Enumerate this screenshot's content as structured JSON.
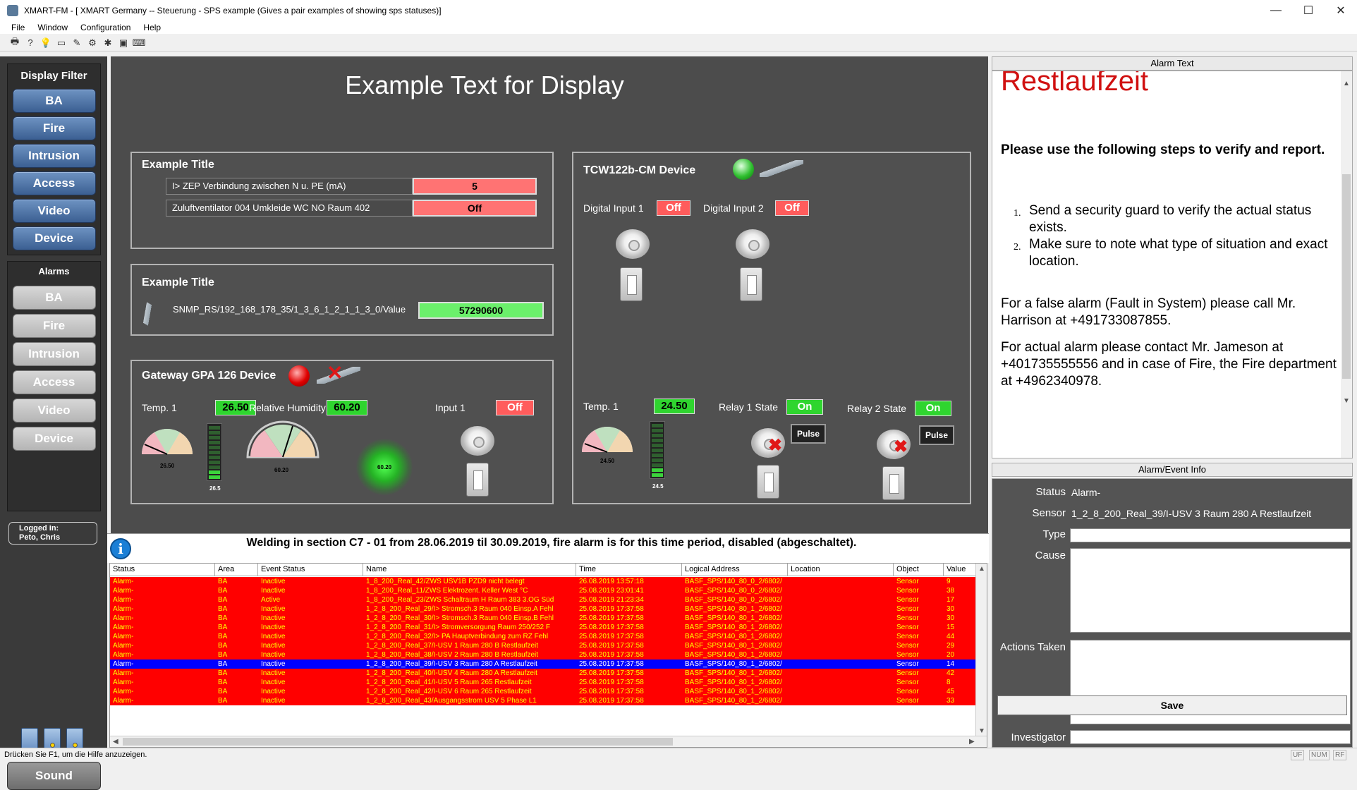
{
  "window": {
    "title": "XMART-FM - [ XMART Germany -- Steuerung - SPS example (Gives a pair examples of showing sps statuses)]",
    "controls": {
      "minimize": "—",
      "maximize": "☐",
      "close": "✕"
    }
  },
  "menu": [
    "File",
    "Window",
    "Configuration",
    "Help"
  ],
  "toolbar_icons": [
    "printer-icon",
    "help-icon",
    "bulb-icon",
    "window-icon",
    "tools-icon",
    "gear-icon",
    "puzzle-icon",
    "box-icon",
    "terminal-icon"
  ],
  "display_filter": {
    "title": "Display Filter",
    "buttons": [
      "BA",
      "Fire",
      "Intrusion",
      "Access",
      "Video",
      "Device"
    ]
  },
  "alarms_filter": {
    "title": "Alarms",
    "buttons": [
      "BA",
      "Fire",
      "Intrusion",
      "Access",
      "Video",
      "Device"
    ]
  },
  "logged_in": {
    "label": "Logged in:",
    "user": "Peto, Chris"
  },
  "sound_label": "Sound",
  "main": {
    "title": "Example Text for Display",
    "panel1": {
      "title": "Example Title",
      "rows": [
        {
          "label": "I> ZEP Verbindung zwischen N u. PE  (mA)",
          "value": "5"
        },
        {
          "label": "Zuluftventilator  004 Umkleide  WC NO Raum 402",
          "value": "Off"
        }
      ]
    },
    "panel2": {
      "title": "Example Title",
      "label": "SNMP_RS/192_168_178_35/1_3_6_1_2_1_1_3_0/Value",
      "value": "57290600"
    },
    "panel3": {
      "title": "Gateway GPA 126 Device",
      "temp_label": "Temp. 1",
      "temp_value": "26.50",
      "gauge1_label": "26.50",
      "bar1_label": "26.5",
      "bar1_level": 0.15,
      "humidity_label": "Relative Humidity",
      "humidity_value": "60.20",
      "gauge2_label": "60.20",
      "glow_label": "60.20",
      "input_label": "Input 1",
      "input_value": "Off"
    },
    "panel4": {
      "title": "TCW122b-CM Device",
      "di1_label": "Digital Input 1",
      "di1_value": "Off",
      "di2_label": "Digital Input 2",
      "di2_value": "Off",
      "temp_label": "Temp. 1",
      "temp_value": "24.50",
      "gauge_label": "24.50",
      "bar_label": "24.5",
      "bar_level": 0.15,
      "relay1_label": "Relay 1 State",
      "relay1_value": "On",
      "relay2_label": "Relay 2 State",
      "relay2_value": "On",
      "pulse_label": "Pulse"
    }
  },
  "info_message": "Welding in section C7 - 01 from 28.06.2019 til 30.09.2019, fire alarm is for this time period, disabled (abgeschaltet).",
  "event_table": {
    "columns": [
      "Status",
      "Area",
      "Event Status",
      "Name",
      "Time",
      "Logical Address",
      "Location",
      "Object",
      "Value"
    ],
    "rows": [
      [
        "Alarm-",
        "BA",
        "Inactive",
        "1_8_200_Real_42/ZWS USV1B PZD9 nicht belegt",
        "26.08.2019 13:57:18",
        "BASF_SPS/140_80_0_2/6802/",
        "",
        "Sensor",
        "9"
      ],
      [
        "Alarm-",
        "BA",
        "Inactive",
        "1_8_200_Real_11/ZWS Elektrozent. Keller West °C",
        "25.08.2019 23:01:41",
        "BASF_SPS/140_80_0_2/6802/",
        "",
        "Sensor",
        "38"
      ],
      [
        "Alarm-",
        "BA",
        "Active",
        "1_8_200_Real_23/ZWS Schaltraum H Raum 383  3.OG Süd",
        "25.08.2019 21:23:34",
        "BASF_SPS/140_80_0_2/6802/",
        "",
        "Sensor",
        "17"
      ],
      [
        "Alarm-",
        "BA",
        "Inactive",
        "1_2_8_200_Real_29/I> Stromsch.3 Raum 040 Einsp.A Fehl",
        "25.08.2019 17:37:58",
        "BASF_SPS/140_80_1_2/6802/",
        "",
        "Sensor",
        "30"
      ],
      [
        "Alarm-",
        "BA",
        "Inactive",
        "1_2_8_200_Real_30/I> Stromsch.3 Raum 040 Einsp.B Fehl",
        "25.08.2019 17:37:58",
        "BASF_SPS/140_80_1_2/6802/",
        "",
        "Sensor",
        "30"
      ],
      [
        "Alarm-",
        "BA",
        "Inactive",
        "1_2_8_200_Real_31/I> Stromversorgung Raum 250/252 F",
        "25.08.2019 17:37:58",
        "BASF_SPS/140_80_1_2/6802/",
        "",
        "Sensor",
        "15"
      ],
      [
        "Alarm-",
        "BA",
        "Inactive",
        "1_2_8_200_Real_32/I> PA Hauptverbindung zum RZ Fehl",
        "25.08.2019 17:37:58",
        "BASF_SPS/140_80_1_2/6802/",
        "",
        "Sensor",
        "44"
      ],
      [
        "Alarm-",
        "BA",
        "Inactive",
        "1_2_8_200_Real_37/I-USV 1 Raum 280 B Restlaufzeit",
        "25.08.2019 17:37:58",
        "BASF_SPS/140_80_1_2/6802/",
        "",
        "Sensor",
        "29"
      ],
      [
        "Alarm-",
        "BA",
        "Inactive",
        "1_2_8_200_Real_38/I-USV 2 Raum 280 B Restlaufzeit",
        "25.08.2019 17:37:58",
        "BASF_SPS/140_80_1_2/6802/",
        "",
        "Sensor",
        "20"
      ],
      [
        "Alarm-",
        "BA",
        "Inactive",
        "1_2_8_200_Real_39/I-USV 3 Raum 280 A Restlaufzeit",
        "25.08.2019 17:37:58",
        "BASF_SPS/140_80_1_2/6802/",
        "",
        "Sensor",
        "14"
      ],
      [
        "Alarm-",
        "BA",
        "Inactive",
        "1_2_8_200_Real_40/I-USV 4 Raum 280 A Restlaufzeit",
        "25.08.2019 17:37:58",
        "BASF_SPS/140_80_1_2/6802/",
        "",
        "Sensor",
        "42"
      ],
      [
        "Alarm-",
        "BA",
        "Inactive",
        "1_2_8_200_Real_41/I-USV 5 Raum 265  Restlaufzeit",
        "25.08.2019 17:37:58",
        "BASF_SPS/140_80_1_2/6802/",
        "",
        "Sensor",
        "8"
      ],
      [
        "Alarm-",
        "BA",
        "Inactive",
        "1_2_8_200_Real_42/I-USV 6 Raum 265  Restlaufzeit",
        "25.08.2019 17:37:58",
        "BASF_SPS/140_80_1_2/6802/",
        "",
        "Sensor",
        "45"
      ],
      [
        "Alarm-",
        "BA",
        "Inactive",
        "1_2_8_200_Real_43/Ausgangsstrom USV 5 Phase L1",
        "25.08.2019 17:37:58",
        "BASF_SPS/140_80_1_2/6802/",
        "",
        "Sensor",
        "33"
      ]
    ],
    "selected_index": 9
  },
  "alarm_text": {
    "header": "Alarm Text",
    "heading": "Restlaufzeit",
    "strong": "Please use the following steps to verify and report.",
    "steps": [
      "Send a security guard to verify the actual status exists.",
      "Make sure to note what type of situation and exact location."
    ],
    "para1": "For a false alarm (Fault in System) please call Mr. Harrison at +491733087855.",
    "para2": "For actual alarm please contact Mr. Jameson at +401735555556 and in case of Fire, the Fire department at +4962340978."
  },
  "event_info": {
    "header": "Alarm/Event Info",
    "status_label": "Status",
    "status_value": "Alarm-",
    "sensor_label": "Sensor",
    "sensor_value": "1_2_8_200_Real_39/I-USV 3 Raum 280 A Restlaufzeit",
    "type_label": "Type",
    "type_value": "",
    "cause_label": "Cause",
    "actions_label": "Actions Taken",
    "investigator_label": "Investigator",
    "investigator_value": "",
    "save_label": "Save"
  },
  "statusbar": {
    "text": "Drücken Sie F1, um die Hilfe anzuzeigen.",
    "indicators": [
      "UF",
      "NUM",
      "RF"
    ]
  }
}
